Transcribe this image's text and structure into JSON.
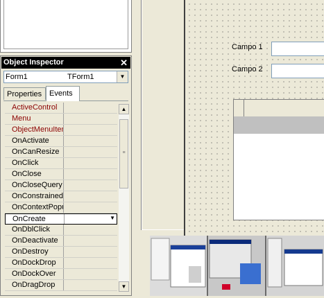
{
  "inspector": {
    "title": "Object Inspector",
    "object_name": "Form1",
    "object_type": "TForm1",
    "tabs": [
      {
        "label": "Properties"
      },
      {
        "label": "Events"
      }
    ],
    "rows": [
      {
        "name": "ActiveControl",
        "value": "",
        "style": "red"
      },
      {
        "name": "Menu",
        "value": "",
        "style": "red"
      },
      {
        "name": "ObjectMenuItem",
        "value": "",
        "style": "red"
      },
      {
        "name": "OnActivate",
        "value": ""
      },
      {
        "name": "OnCanResize",
        "value": ""
      },
      {
        "name": "OnClick",
        "value": ""
      },
      {
        "name": "OnClose",
        "value": ""
      },
      {
        "name": "OnCloseQuery",
        "value": ""
      },
      {
        "name": "OnConstrainedResize",
        "value": ""
      },
      {
        "name": "OnContextPopup",
        "value": ""
      },
      {
        "name": "OnCreate",
        "value": "",
        "style": "selected"
      },
      {
        "name": "OnDblClick",
        "value": ""
      },
      {
        "name": "OnDeactivate",
        "value": ""
      },
      {
        "name": "OnDestroy",
        "value": ""
      },
      {
        "name": "OnDockDrop",
        "value": ""
      },
      {
        "name": "OnDockOver",
        "value": ""
      },
      {
        "name": "OnDragDrop",
        "value": ""
      }
    ]
  },
  "form": {
    "label1": "Campo 1",
    "label2": "Campo 2"
  },
  "colors": {
    "title_bar": "#000000",
    "event_red": "#8b0000",
    "face": "#ece9d8"
  }
}
